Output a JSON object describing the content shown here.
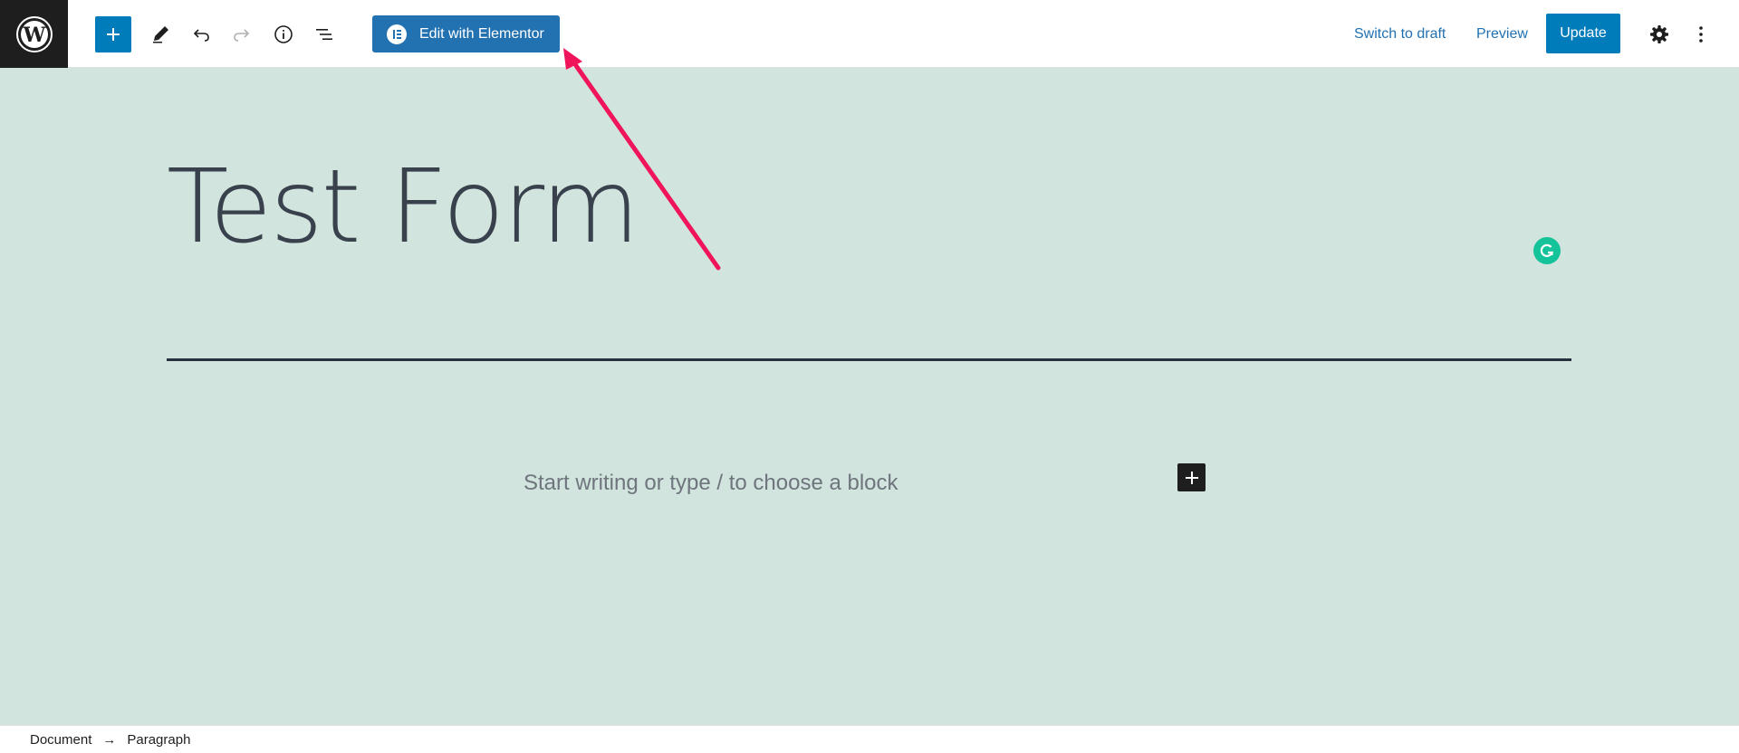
{
  "toolbar": {
    "logo_icon": "wordpress-logo-icon",
    "add_block_icon": "plus-icon",
    "tools_icon": "pencil-icon",
    "undo_icon": "undo-icon",
    "redo_icon": "redo-icon",
    "details_icon": "info-icon",
    "list_view_icon": "list-view-icon",
    "edit_with_elementor_label": "Edit with Elementor",
    "switch_to_draft_label": "Switch to draft",
    "preview_label": "Preview",
    "update_label": "Update",
    "settings_icon": "gear-icon",
    "more_options_icon": "vertical-ellipsis-icon",
    "accent_color": "#007cba"
  },
  "editor": {
    "post_title": "Test Form",
    "placeholder": "Start writing or type / to choose a block",
    "background_color": "#d1e4dd",
    "annotation_arrow_color": "#f0145a"
  },
  "footer": {
    "breadcrumb": [
      "Document",
      "Paragraph"
    ],
    "separator": "→"
  }
}
